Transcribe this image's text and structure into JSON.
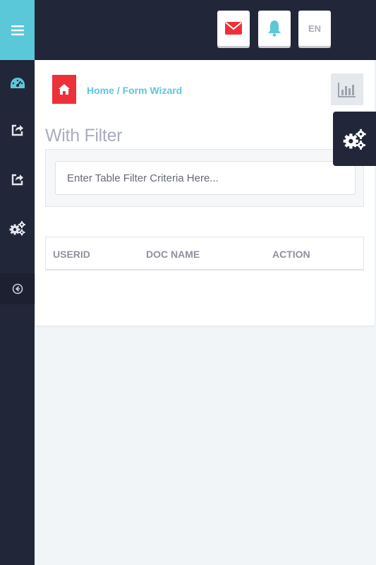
{
  "breadcrumb": {
    "home": "Home",
    "separator": " / ",
    "current": "Form Wizard"
  },
  "section": {
    "title": "With Filter"
  },
  "filter": {
    "placeholder": "Enter Table Filter Criteria Here..."
  },
  "table": {
    "columns": [
      "USERID",
      "DOC NAME",
      "ACTION"
    ]
  },
  "topbar": {
    "lang": "EN"
  },
  "icons": {
    "menu": "hamburger-icon",
    "dashboard": "speedometer-icon",
    "share1": "share-icon",
    "share2": "share-icon",
    "settings": "gears-icon",
    "collapse": "arrow-left-circle-icon",
    "mail": "envelope-icon",
    "bell": "bell-icon",
    "home": "home-icon",
    "chart": "bar-chart-icon",
    "settings_tab": "gears-icon"
  },
  "colors": {
    "accent": "#5bc8da",
    "danger": "#ee3139",
    "dark": "#222639"
  }
}
